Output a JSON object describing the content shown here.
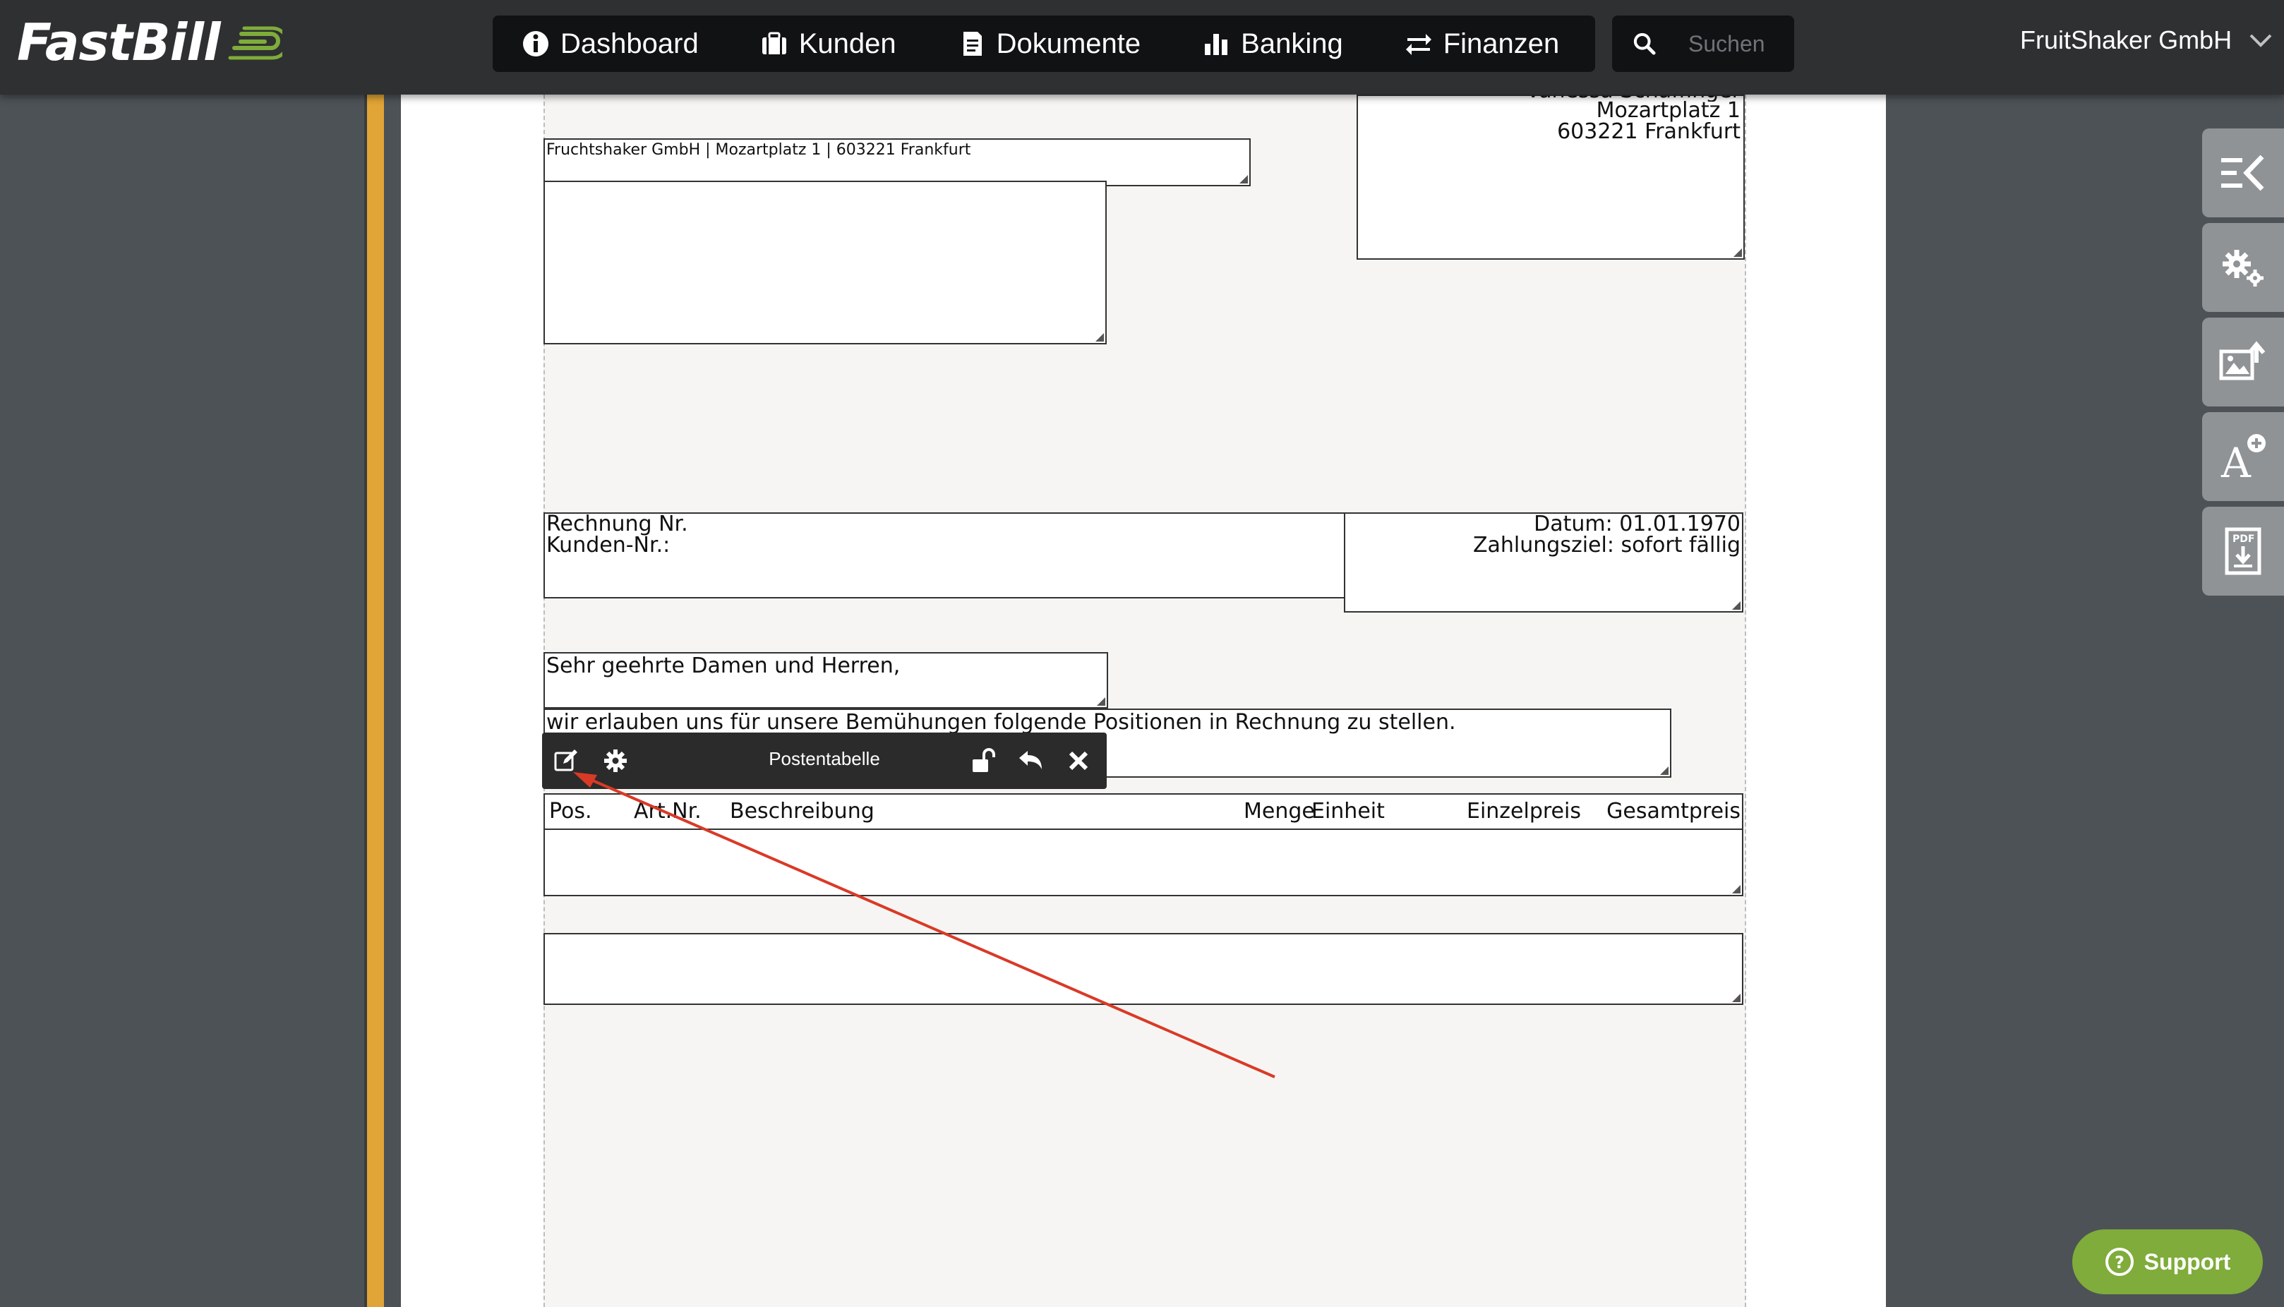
{
  "app": {
    "logo_text": "FastBill",
    "company_name": "FruitShaker GmbH"
  },
  "nav": {
    "items": [
      {
        "label": "Dashboard",
        "icon": "info-icon"
      },
      {
        "label": "Kunden",
        "icon": "briefcase-icon"
      },
      {
        "label": "Dokumente",
        "icon": "document-icon"
      },
      {
        "label": "Banking",
        "icon": "bar-chart-icon"
      },
      {
        "label": "Finanzen",
        "icon": "swap-arrows-icon"
      }
    ]
  },
  "search": {
    "placeholder": "Suchen"
  },
  "document": {
    "sender_line": "Fruchtshaker GmbH | Mozartplatz 1 | 603221 Frankfurt",
    "sender_address": {
      "name": "Vanessa Schaffinger",
      "street": "Mozartplatz 1",
      "city": "603221 Frankfurt"
    },
    "invoice_no_label": "Rechnung Nr.",
    "customer_no_label": "Kunden-Nr.:",
    "date_line": "Datum: 01.01.1970",
    "payment_line": "Zahlungsziel: sofort fällig",
    "salutation": "Sehr geehrte Damen und Herren,",
    "intro_text": "wir erlauben uns für unsere Bemühungen folgende Positionen in Rechnung zu stellen.",
    "table_headers": {
      "pos": "Pos.",
      "artnr": "Art.Nr.",
      "beschreibung": "Beschreibung",
      "menge": "Menge",
      "einheit": "Einheit",
      "einzelpreis": "Einzelpreis",
      "gesamtpreis": "Gesamtpreis"
    }
  },
  "element_toolbar": {
    "title": "Postentabelle",
    "icons": [
      "edit-icon",
      "gear-icon",
      "unlock-icon",
      "undo-icon",
      "close-icon"
    ]
  },
  "right_tools": [
    {
      "icon": "collapse-panel-icon"
    },
    {
      "icon": "settings-gears-icon"
    },
    {
      "icon": "image-upload-icon"
    },
    {
      "icon": "add-text-icon"
    },
    {
      "icon": "pdf-download-icon"
    }
  ],
  "support": {
    "label": "Support"
  },
  "colors": {
    "topbar": "#2e3032",
    "navbar": "#111214",
    "accent_orange": "#e1a436",
    "support_green": "#7fac3a",
    "annotation_arrow": "#d93a26"
  }
}
